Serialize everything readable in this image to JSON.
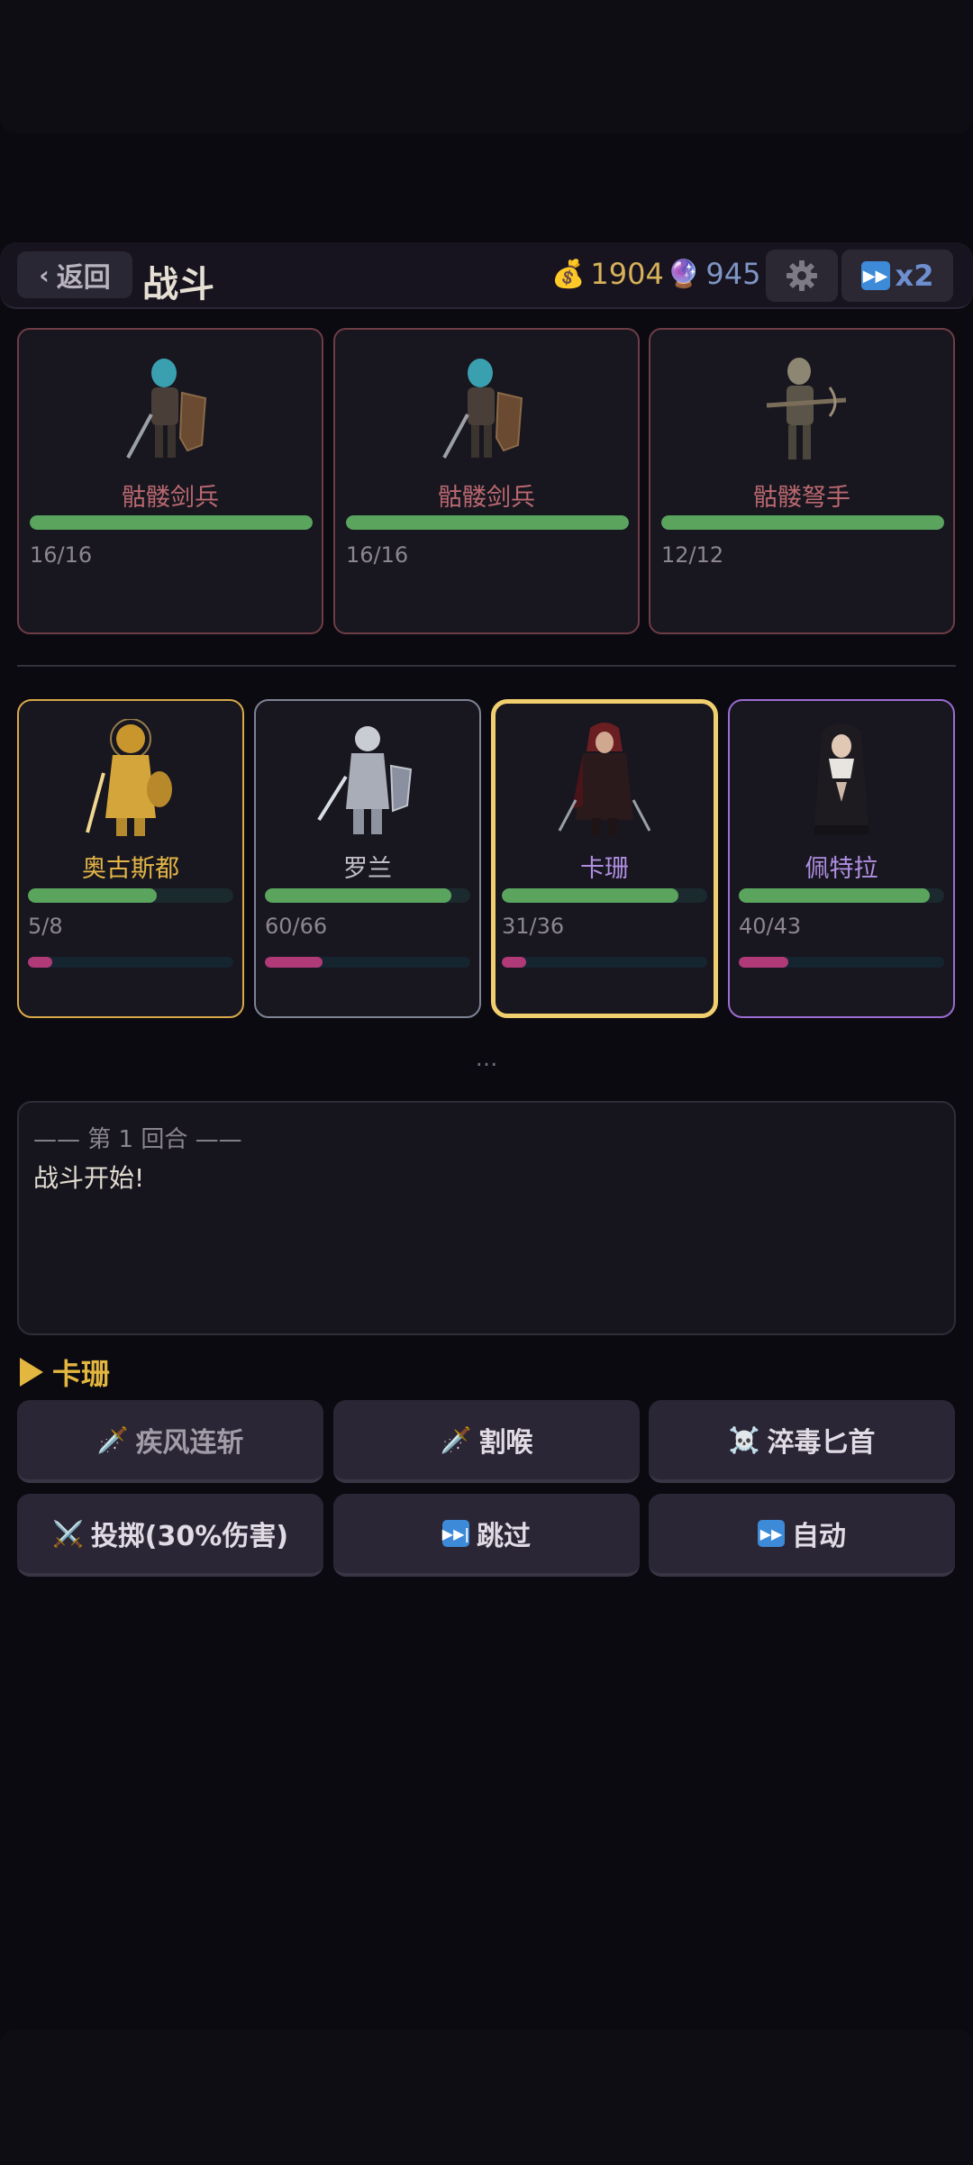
{
  "header": {
    "back_label": "返回",
    "title": "战斗",
    "gold": "1904",
    "gems": "945",
    "speed_label": "x2"
  },
  "enemies": [
    {
      "name": "骷髅剑兵",
      "hp": "16/16",
      "hp_fraction": 1.0
    },
    {
      "name": "骷髅剑兵",
      "hp": "16/16",
      "hp_fraction": 1.0
    },
    {
      "name": "骷髅弩手",
      "hp": "12/12",
      "hp_fraction": 1.0
    }
  ],
  "heroes": [
    {
      "name": "奥古斯都",
      "hp": "5/8",
      "hp_fraction": 0.625,
      "energy_fraction": 0.12,
      "border_color": "#d9a94a",
      "name_color": "#e4b646"
    },
    {
      "name": "罗兰",
      "hp": "60/66",
      "hp_fraction": 0.91,
      "energy_fraction": 0.28,
      "border_color": "#7e8394",
      "name_color": "#c3bfc6"
    },
    {
      "name": "卡珊",
      "hp": "31/36",
      "hp_fraction": 0.86,
      "energy_fraction": 0.12,
      "border_color": "#f1cf6e",
      "name_color": "#b08fe2",
      "active": true
    },
    {
      "name": "佩特拉",
      "hp": "40/43",
      "hp_fraction": 0.93,
      "energy_fraction": 0.24,
      "border_color": "#9b6cd1",
      "name_color": "#b08fe2"
    }
  ],
  "ellipsis": "...",
  "log": {
    "round_label": "—— 第 1 回合 ——",
    "lines": [
      "战斗开始!"
    ]
  },
  "turn": {
    "hero_name": "卡珊"
  },
  "actions": [
    {
      "label": "疾风连斩",
      "icon": "dagger-icon",
      "emoji": "🗡️"
    },
    {
      "label": "割喉",
      "icon": "dagger-icon",
      "emoji": "🗡️"
    },
    {
      "label": "淬毒匕首",
      "icon": "skull-crossbones-icon",
      "emoji": "☠️"
    },
    {
      "label": "投掷(30%伤害)",
      "icon": "crossed-swords-icon",
      "emoji": "⚔️"
    },
    {
      "label": "跳过",
      "icon": "next-track-icon",
      "emoji": "⏭"
    },
    {
      "label": "自动",
      "icon": "fast-forward-icon",
      "emoji": "⏩"
    }
  ],
  "colors": {
    "hp_bar": "#5aa45e",
    "energy_bar": "#b03a78",
    "enemy_border": "#6e3d46",
    "gold": "#d7b25a",
    "turn_accent": "#e3b640"
  }
}
